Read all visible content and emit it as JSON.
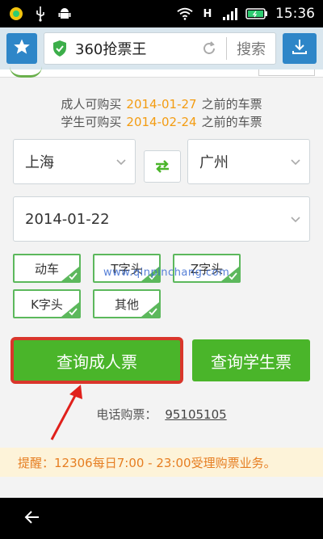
{
  "status_bar": {
    "time": "15:36",
    "network_label": "H"
  },
  "browser": {
    "site_title": "360抢票王",
    "search_placeholder": "搜索"
  },
  "notice": {
    "adult_prefix": "成人可购买",
    "adult_date": "2014-01-27",
    "adult_suffix": "之前的车票",
    "student_prefix": "学生可购买",
    "student_date": "2014-02-24",
    "student_suffix": "之前的车票"
  },
  "form": {
    "from_station": "上海",
    "to_station": "广州",
    "date": "2014-01-22"
  },
  "train_types": [
    {
      "label": "动车"
    },
    {
      "label": "T字头"
    },
    {
      "label": "Z字头"
    },
    {
      "label": "K字头"
    },
    {
      "label": "其他"
    }
  ],
  "buttons": {
    "query_adult": "查询成人票",
    "query_student": "查询学生票"
  },
  "phone": {
    "label": "电话购票：",
    "number": "95105105"
  },
  "reminder": "提醒：12306每日7:00 - 23:00受理购票业务。",
  "watermark": "www.qinpinchang.com",
  "colors": {
    "accent_green": "#4ab52a",
    "date_orange": "#f39c12",
    "highlight_red": "#d9362b",
    "browser_blue": "#2e86c8"
  }
}
